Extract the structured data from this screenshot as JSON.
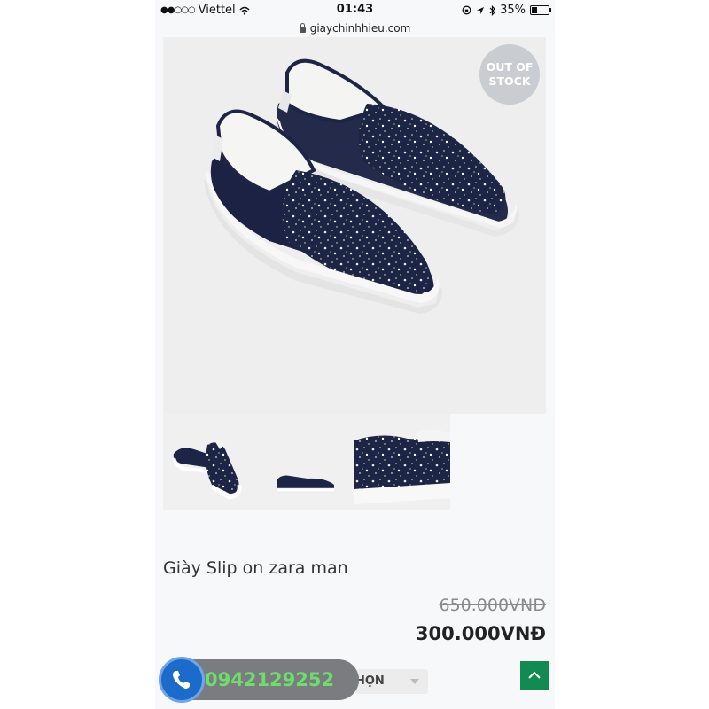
{
  "status_bar": {
    "signal": "●●○○○",
    "carrier": "Viettel",
    "time": "01:43",
    "battery_text": "35%",
    "battery_level": 0.35
  },
  "browser": {
    "url": "giaychinhhieu.com"
  },
  "product": {
    "badge_line1": "OUT OF",
    "badge_line2": "STOCK",
    "title": "Giày Slip on zara man",
    "old_price": "650.000VNĐ",
    "price": "300.000VNĐ",
    "select_label": "HỌN"
  },
  "contact": {
    "phone": "0942129252"
  },
  "colors": {
    "accent_green": "#138a52",
    "call_blue": "#1c6ac9",
    "shoe_navy": "#1d2546"
  }
}
